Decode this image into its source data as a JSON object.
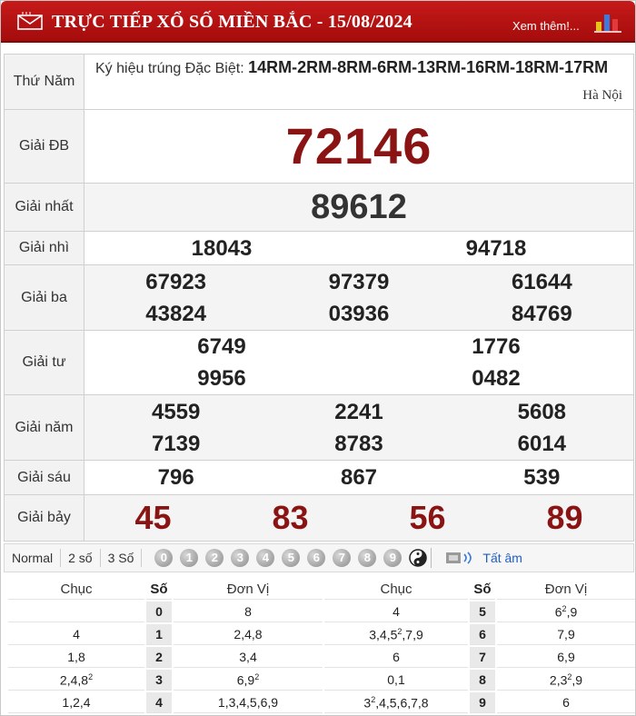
{
  "header": {
    "title": "TRỰC TIẾP XỔ SỐ MIỀN BẮC - 15/08/2024",
    "more_link": "Xem thêm!...",
    "mail_icon": "mail-icon",
    "chart_icon": "bar-chart-icon",
    "bg_color": "#b81414"
  },
  "results": {
    "day": "Thứ Năm",
    "special_code_lead": "Ký hiệu trúng Đặc Biệt: ",
    "special_code": "14RM-2RM-8RM-6RM-13RM-16RM-18RM-17RM",
    "location": "Hà Nội",
    "prizes": {
      "db": {
        "label": "Giải ĐB",
        "numbers": [
          "72146"
        ]
      },
      "nhat": {
        "label": "Giải nhất",
        "numbers": [
          "89612"
        ]
      },
      "nhi": {
        "label": "Giải nhì",
        "numbers": [
          "18043",
          "94718"
        ]
      },
      "ba": {
        "label": "Giải ba",
        "numbers": [
          "67923",
          "97379",
          "61644",
          "43824",
          "03936",
          "84769"
        ]
      },
      "tu": {
        "label": "Giải tư",
        "numbers": [
          "6749",
          "1776",
          "9956",
          "0482"
        ]
      },
      "nam": {
        "label": "Giải năm",
        "numbers": [
          "4559",
          "2241",
          "5608",
          "7139",
          "8783",
          "6014"
        ]
      },
      "sau": {
        "label": "Giải sáu",
        "numbers": [
          "796",
          "867",
          "539"
        ]
      },
      "bay": {
        "label": "Giải bảy",
        "numbers": [
          "45",
          "83",
          "56",
          "89"
        ]
      }
    }
  },
  "toolbar": {
    "options": [
      "Normal",
      "2 số",
      "3 Số"
    ],
    "digits": [
      "0",
      "1",
      "2",
      "3",
      "4",
      "5",
      "6",
      "7",
      "8",
      "9"
    ],
    "yinyang_icon": "yin-yang-icon",
    "speaker_icon": "speaker-icon",
    "all_label": "Tất âm"
  },
  "loto": {
    "headers": [
      "Chục",
      "Số",
      "Đơn Vị",
      "Chục",
      "Số",
      "Đơn Vị"
    ],
    "rows": [
      {
        "lc": "",
        "ls": "0",
        "lu": "8",
        "rc": "4",
        "rs": "5",
        "ru": "6<sup>2</sup>,9"
      },
      {
        "lc": "4",
        "ls": "1",
        "lu": "2,4,8",
        "rc": "3,4,5<sup>2</sup>,7,9",
        "rs": "6",
        "ru": "7,9"
      },
      {
        "lc": "1,8",
        "ls": "2",
        "lu": "3,4",
        "rc": "6",
        "rs": "7",
        "ru": "6,9"
      },
      {
        "lc": "2,4,8<sup>2</sup>",
        "ls": "3",
        "lu": "6,9<sup>2</sup>",
        "rc": "0,1",
        "rs": "8",
        "ru": "2,3<sup>2</sup>,9"
      },
      {
        "lc": "1,2,4",
        "ls": "4",
        "lu": "1,3,4,5,6,9",
        "rc": "3<sup>2</sup>,4,5,6,7,8",
        "rs": "9",
        "ru": "6"
      }
    ]
  }
}
